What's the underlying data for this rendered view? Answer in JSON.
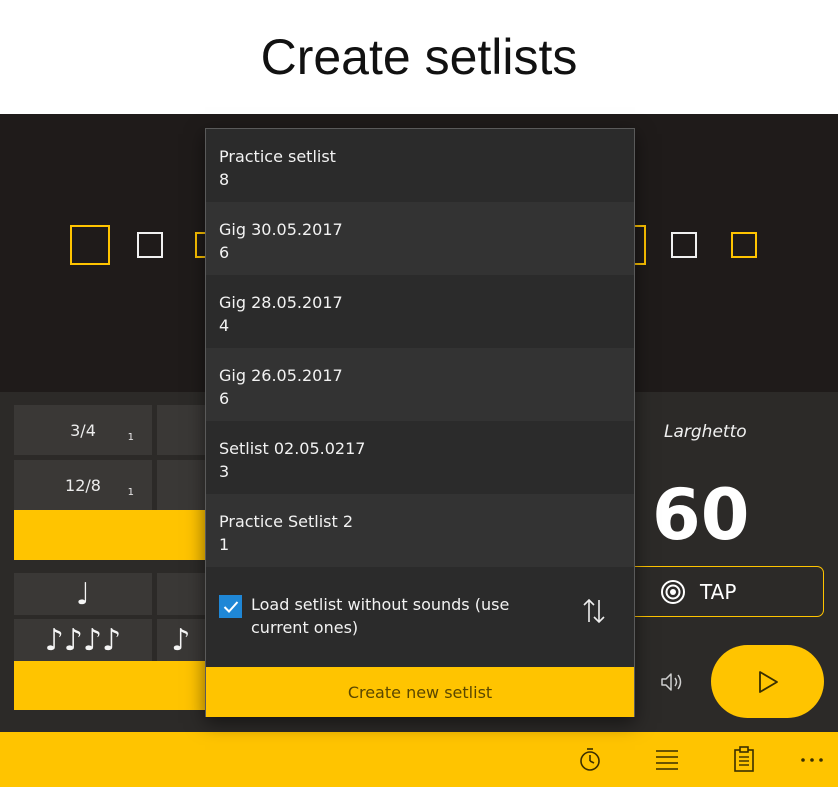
{
  "heading": "Create setlists",
  "time_signatures": [
    {
      "label": "3/4",
      "sub": "1"
    },
    {
      "label": "12/8",
      "sub": "1"
    }
  ],
  "notes": {
    "quarter": "♩",
    "sixteenths": "♪♪♪♪",
    "eighth": "♪"
  },
  "tempo": {
    "name": "Larghetto",
    "bpm": "60",
    "tap_label": "TAP"
  },
  "dropdown": {
    "setlists": [
      {
        "name": "Practice setlist",
        "count": "8"
      },
      {
        "name": "Gig 30.05.2017",
        "count": "6"
      },
      {
        "name": "Gig 28.05.2017",
        "count": "4"
      },
      {
        "name": "Gig 26.05.2017",
        "count": "6"
      },
      {
        "name": "Setlist 02.05.0217",
        "count": "3"
      },
      {
        "name": "Practice Setlist 2",
        "count": "1"
      }
    ],
    "load_without_sounds_label": "Load setlist without sounds (use current ones)",
    "load_without_sounds_checked": true,
    "create_button_label": "Create new setlist"
  },
  "bottom_bar_icons": [
    "stopwatch-icon",
    "list-icon",
    "clipboard-icon",
    "more-icon"
  ],
  "colors": {
    "accent": "#ffc400",
    "checkbox": "#1f87d6",
    "background": "#1f1b1a",
    "panel": "#2c2a28"
  }
}
